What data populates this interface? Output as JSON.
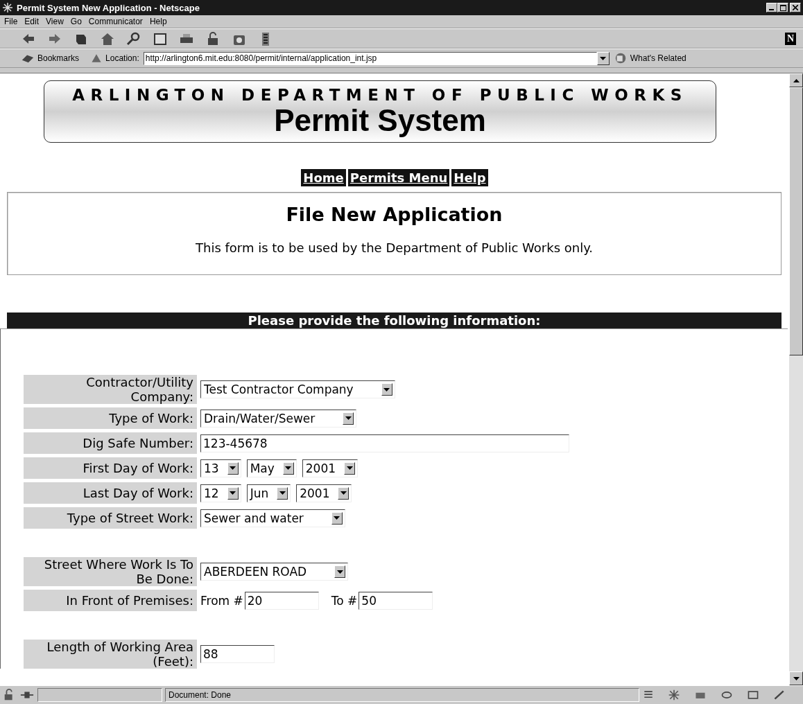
{
  "window": {
    "title": "Permit System New Application - Netscape"
  },
  "menu": [
    "File",
    "Edit",
    "View",
    "Go",
    "Communicator",
    "Help"
  ],
  "toolbar": {
    "logo": "N"
  },
  "location_bar": {
    "bookmarks": "Bookmarks",
    "label": "Location:",
    "url": "http://arlington6.mit.edu:8080/permit/internal/application_int.jsp",
    "related": "What's Related"
  },
  "banner": {
    "department": "ARLINGTON DEPARTMENT OF PUBLIC WORKS",
    "system": "Permit System"
  },
  "nav": [
    "Home",
    "Permits Menu",
    "Help"
  ],
  "intro": {
    "heading": "File New Application",
    "text": "This form is to be used by the Department of Public Works only."
  },
  "form": {
    "header": "Please provide the following information:",
    "rows": [
      {
        "label": "Contractor/Utility Company:",
        "kind": "select",
        "values": [
          "Test Contractor Company"
        ]
      },
      {
        "label": "Type of Work:",
        "kind": "select",
        "values": [
          "Drain/Water/Sewer"
        ]
      },
      {
        "label": "Dig Safe Number:",
        "kind": "text",
        "values": [
          "123-45678"
        ]
      },
      {
        "label": "First Day of Work:",
        "kind": "date",
        "values": [
          "13",
          "May",
          "2001"
        ]
      },
      {
        "label": "Last Day of Work:",
        "kind": "date",
        "values": [
          "12",
          "Jun",
          "2001"
        ]
      },
      {
        "label": "Type of Street Work:",
        "kind": "select",
        "values": [
          "Sewer and water"
        ]
      },
      {
        "kind": "blank"
      },
      {
        "label": "Street Where Work Is To Be Done:",
        "kind": "select",
        "values": [
          "ABERDEEN ROAD"
        ]
      },
      {
        "label": "In Front of Premises:",
        "kind": "range",
        "from_label": "From #",
        "to_label": "To #",
        "values": [
          "20",
          "50"
        ]
      },
      {
        "kind": "blank"
      },
      {
        "label": "Length of Working Area (Feet):",
        "kind": "short",
        "values": [
          "88"
        ]
      }
    ]
  },
  "status_bar": {
    "text": "Document: Done"
  }
}
